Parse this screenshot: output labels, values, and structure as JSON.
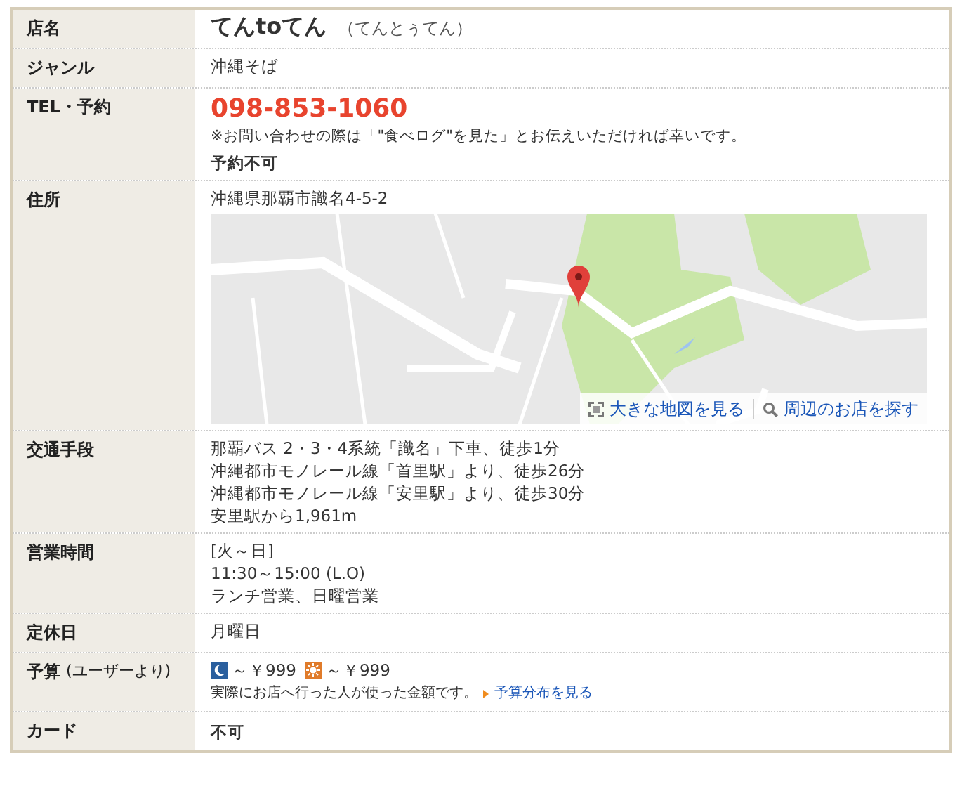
{
  "rows": [
    {
      "kind": "name",
      "label": "店名",
      "name": "てんtoてん",
      "reading": "（てんとぅてん）"
    },
    {
      "kind": "text",
      "label": "ジャンル",
      "lines": [
        "沖縄そば"
      ]
    },
    {
      "kind": "tel",
      "label": "TEL・予約",
      "phone": "098-853-1060",
      "note": "※お問い合わせの際は「\"食べログ\"を見た」とお伝えいただければ幸いです。",
      "reservation": "予約不可"
    },
    {
      "kind": "address",
      "label": "住所",
      "address": "沖縄県那覇市識名4-5-2",
      "map_links": [
        "大きな地図を見る",
        "周辺のお店を探す"
      ]
    },
    {
      "kind": "text",
      "label": "交通手段",
      "lines": [
        "那覇バス 2・3・4系統「識名」下車、徒歩1分",
        "沖縄都市モノレール線「首里駅」より、徒歩26分",
        "沖縄都市モノレール線「安里駅」より、徒歩30分",
        "安里駅から1,961m"
      ]
    },
    {
      "kind": "text",
      "label": "営業時間",
      "lines": [
        "[火～日]",
        "11:30～15:00 (L.O)",
        "ランチ営業、日曜営業"
      ]
    },
    {
      "kind": "text",
      "label": "定休日",
      "lines": [
        "月曜日"
      ]
    },
    {
      "kind": "budget",
      "label": "予算",
      "label_note": "(ユーザーより)",
      "dinner": "～￥999",
      "lunch": "～￥999",
      "note": "実際にお店へ行った人が使った金額です。",
      "link": "予算分布を見る"
    },
    {
      "kind": "strong",
      "label": "カード",
      "value": "不可"
    }
  ]
}
